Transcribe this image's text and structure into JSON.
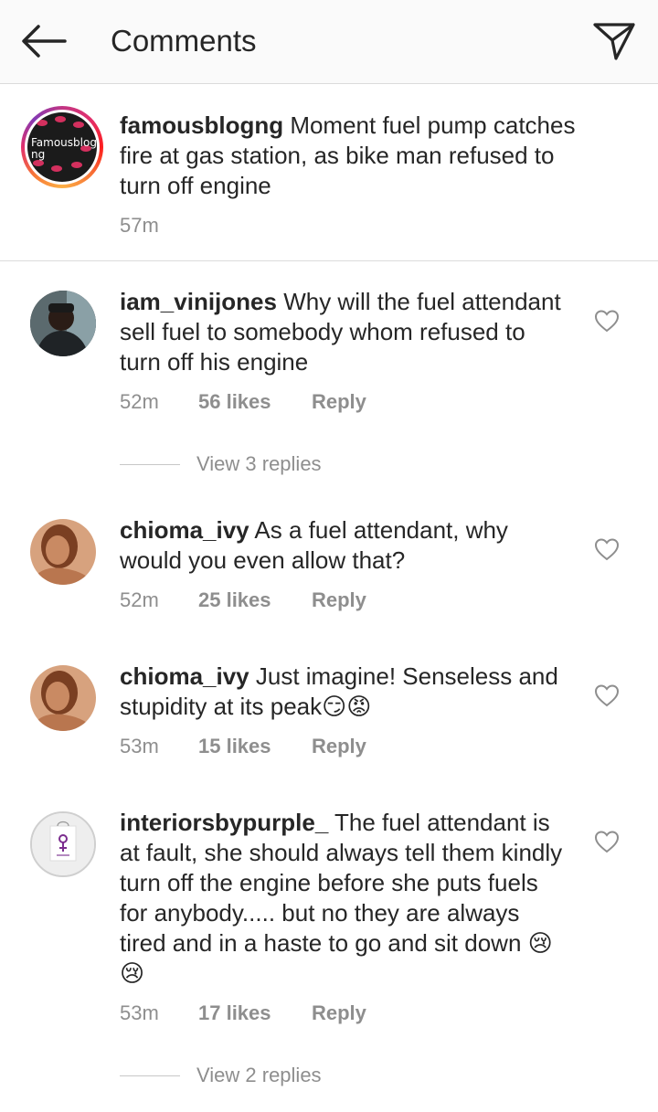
{
  "header": {
    "title": "Comments",
    "back_icon": "arrow-left-icon",
    "send_icon": "paper-plane-icon"
  },
  "caption": {
    "username": "famousblogng",
    "text": " Moment fuel pump catches fire at gas station, as bike man refused to turn off engine",
    "time": "57m",
    "avatar_text": "Famousblog\nng"
  },
  "comments": [
    {
      "username": "iam_vinijones",
      "text": " Why will the fuel attendant sell fuel to somebody whom refused to turn off his engine",
      "time": "52m",
      "likes": "56 likes",
      "reply": "Reply",
      "view_replies": "View 3 replies"
    },
    {
      "username": "chioma_ivy",
      "text": " As a fuel attendant, why would you even allow that?",
      "time": "52m",
      "likes": "25 likes",
      "reply": "Reply"
    },
    {
      "username": "chioma_ivy",
      "text": " Just imagine! Senseless and stupidity at its peak",
      "emoji": "😏😡",
      "time": "53m",
      "likes": "15 likes",
      "reply": "Reply"
    },
    {
      "username": "interiorsbypurple_",
      "text": " The fuel attendant is at fault, she should always tell them kindly turn off the engine before she puts fuels for anybody..... but no they are always tired and in a haste to go and sit down ",
      "emoji": "😢😢",
      "time": "53m",
      "likes": "17 likes",
      "reply": "Reply",
      "view_replies": "View 2 replies"
    }
  ],
  "colors": {
    "text": "#262626",
    "secondary": "#8e8e8e",
    "divider": "#dbdbdb",
    "header_bg": "#fafafa"
  }
}
